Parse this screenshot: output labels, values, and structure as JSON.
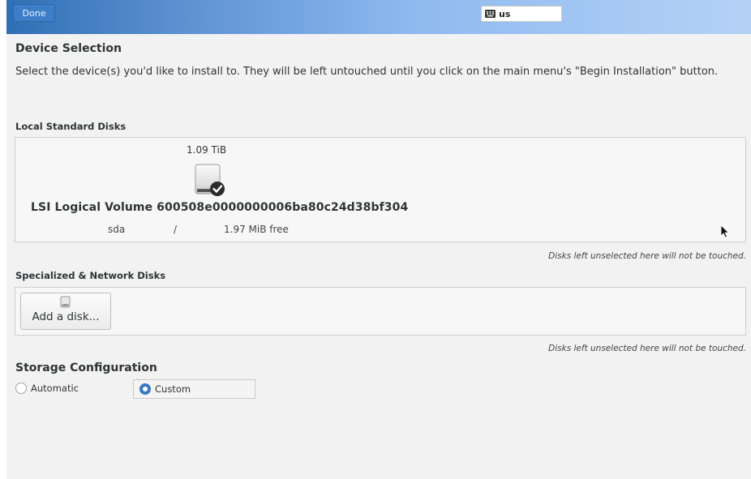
{
  "header": {
    "done_label": "Done",
    "keyboard_layout": "us"
  },
  "device_selection": {
    "title": "Device Selection",
    "intro": "Select the device(s) you'd like to install to.  They will be left untouched until you click on the main menu's \"Begin Installation\" button."
  },
  "local_disks": {
    "heading": "Local Standard Disks",
    "disk": {
      "size": "1.09 TiB",
      "name": "LSI Logical Volume 600508e0000000006ba80c24d38bf304",
      "device": "sda",
      "separator": "/",
      "free": "1.97 MiB free",
      "selected": true
    },
    "note": "Disks left unselected here will not be touched."
  },
  "specialized_disks": {
    "heading": "Specialized & Network Disks",
    "add_label": "Add a disk...",
    "note": "Disks left unselected here will not be touched."
  },
  "storage_config": {
    "title": "Storage Configuration",
    "options": [
      {
        "label": "Automatic",
        "selected": false
      },
      {
        "label": "Custom",
        "selected": true
      }
    ]
  },
  "colors": {
    "accent": "#3a78c2",
    "header_start": "#2f6fb4",
    "header_end": "#b5d2f6"
  }
}
